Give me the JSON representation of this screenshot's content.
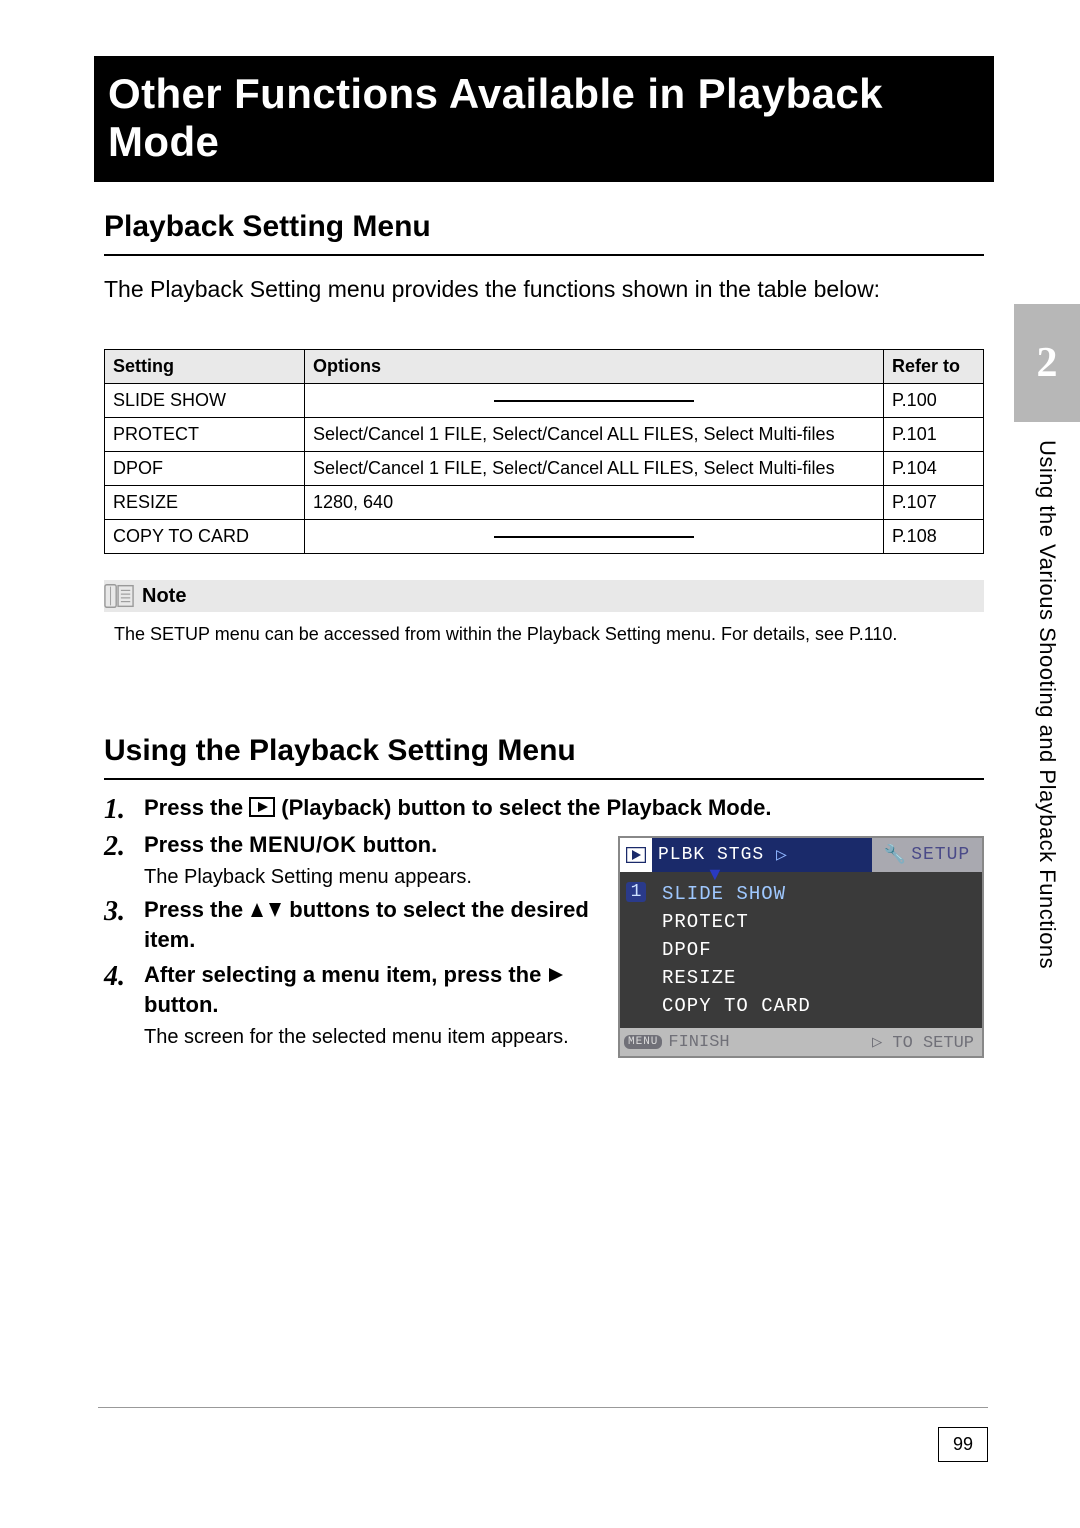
{
  "title_bar": "Other Functions Available in Playback Mode",
  "section1": {
    "heading": "Playback Setting Menu",
    "intro": "The Playback Setting menu provides the functions shown in the table below:"
  },
  "table": {
    "headers": {
      "setting": "Setting",
      "options": "Options",
      "refer": "Refer to"
    },
    "rows": [
      {
        "setting": "SLIDE SHOW",
        "options": "",
        "dash": true,
        "refer": "P.100"
      },
      {
        "setting": "PROTECT",
        "options": "Select/Cancel 1 FILE, Select/Cancel ALL FILES, Select Multi-files",
        "dash": false,
        "refer": "P.101"
      },
      {
        "setting": "DPOF",
        "options": "Select/Cancel 1 FILE, Select/Cancel ALL FILES, Select Multi-files",
        "dash": false,
        "refer": "P.104"
      },
      {
        "setting": "RESIZE",
        "options": "1280, 640",
        "dash": false,
        "refer": "P.107"
      },
      {
        "setting": "COPY TO CARD",
        "options": "",
        "dash": true,
        "refer": "P.108"
      }
    ]
  },
  "note": {
    "label": "Note",
    "body": "The SETUP menu can be accessed from within the Playback Setting menu. For details, see P.110."
  },
  "section2": {
    "heading": "Using the Playback Setting Menu"
  },
  "steps": [
    {
      "title_pre": "Press the ",
      "title_post": " (Playback) button to select the Playback Mode.",
      "desc": ""
    },
    {
      "title_pre": "Press the ",
      "title_mid": "MENU/OK",
      "title_post": " button.",
      "desc": "The Playback Setting menu appears."
    },
    {
      "title_pre": "Press the ",
      "title_post": " buttons to select the desired item.",
      "desc": ""
    },
    {
      "title_pre": "After selecting a menu item, press the ",
      "title_post": " button.",
      "desc": "The screen for the selected menu item appears."
    }
  ],
  "illustration": {
    "tab_main": "PLBK STGS",
    "tab_setup": "SETUP",
    "page_indicator": "1",
    "items": [
      "SLIDE SHOW",
      "PROTECT",
      "DPOF",
      "RESIZE",
      "COPY TO CARD"
    ],
    "bottom_menu_chip": "MENU",
    "bottom_left": "FINISH",
    "bottom_right_prefix": "▷ ",
    "bottom_right": "TO SETUP"
  },
  "side": {
    "chapter_number": "2",
    "chapter_title": "Using the Various Shooting and Playback Functions"
  },
  "page_number": "99"
}
